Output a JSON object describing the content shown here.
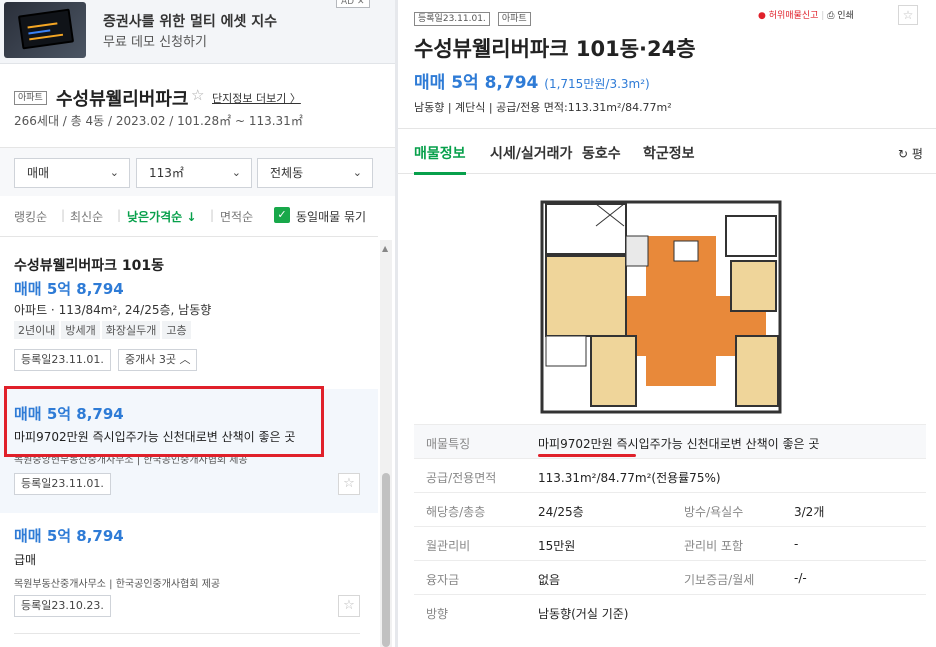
{
  "ad": {
    "title": "증권사를 위한 멀티 에셋 지수",
    "subtitle": "무료 데모 신청하기",
    "badge": "AD ✕"
  },
  "complex": {
    "type_tag": "아파트",
    "name": "수성뷰웰리버파크",
    "star": "☆",
    "more_link": "단지정보 더보기 〉",
    "meta": "266세대 / 총 4동 / 2023.02 / 101.28㎡ ~ 113.31㎡"
  },
  "filters": {
    "trade_type": "매매",
    "area": "113㎡",
    "dong": "전체동",
    "chevron": "⌄"
  },
  "sort": {
    "ranking": "랭킹순",
    "latest": "최신순",
    "low_price": "낮은가격순 ↓",
    "area": "면적순",
    "same_listing": "동일매물 묶기",
    "check": "✓",
    "sep": "|"
  },
  "listings": [
    {
      "title": "수성뷰웰리버파크 101동",
      "price": "매매 5억 8,794",
      "spec": "아파트 · 113/84m², 24/25층, 남동향",
      "chips": [
        "2년이내",
        "방세개",
        "화장실두개",
        "고층"
      ],
      "date": "등록일23.11.01.",
      "agents_btn": "중개사 3곳 ︿"
    },
    {
      "price": "매매 5억 8,794",
      "desc": "마피9702만원 즉시입주가능 신천대로변 산책이 좋은 곳",
      "agent": "목원중앙현부동산중개사무소 | 한국공인중개사협회 제공",
      "date": "등록일23.11.01."
    },
    {
      "price": "매매 5억 8,794",
      "desc": "급매",
      "agent": "목원부동산중개사무소 | 한국공인중개사협회 제공",
      "date": "등록일23.10.23."
    }
  ],
  "detail": {
    "reg_tag": "등록일23.11.01.",
    "apt_tag": "아파트",
    "report": "● 허위매물신고",
    "print": "⎙ 인쇄",
    "title": "수성뷰웰리버파크 101동·24층",
    "price": "매매 5억 8,794",
    "price_unit": "(1,715만원/3.3m²)",
    "meta": "남동향 | 계단식 | 공급/전용 면적:113.31m²/84.77m²",
    "tabs": [
      "매물정보",
      "시세/실거래가",
      "동호수",
      "학군정보"
    ],
    "tab_right": "↻ 평",
    "rows": [
      {
        "label": "매물특징",
        "value": "마피9702만원 즉시입주가능 신천대로변 산책이 좋은 곳"
      },
      {
        "label": "공급/전용면적",
        "value": "113.31m²/84.77m²(전용률75%)"
      },
      {
        "label": "해당층/총층",
        "value": "24/25층",
        "label2": "방수/욕실수",
        "value2": "3/2개"
      },
      {
        "label": "월관리비",
        "value": "15만원",
        "label2": "관리비 포함",
        "value2": "-"
      },
      {
        "label": "융자금",
        "value": "없음",
        "label2": "기보증금/월세",
        "value2": "-/-"
      },
      {
        "label": "방향",
        "value": "남동향(거실 기준)"
      }
    ]
  },
  "colors": {
    "price": "#2e7bd6",
    "accent_green": "#07a04b",
    "highlight_red": "#e0202a"
  }
}
